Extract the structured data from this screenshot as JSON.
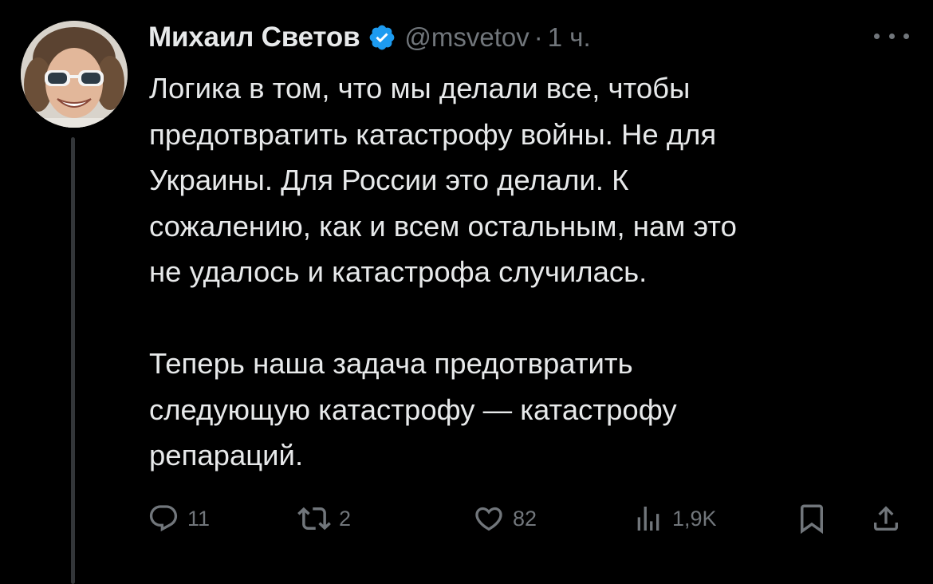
{
  "tweet": {
    "author_name": "Михаил Светов",
    "handle": "@msvetov",
    "separator": "·",
    "time": "1 ч.",
    "paragraphs": [
      [
        "Логика в том, что мы делали все, чтобы",
        "предотвратить катастрофу войны. Не для",
        "Украины. Для России это делали. К",
        "сожалению, как и всем остальным, нам это",
        "не удалось и катастрофа случилась."
      ],
      [
        "Теперь наша задача предотвратить",
        "следующую катастрофу — катастрофу",
        "репараций."
      ]
    ]
  },
  "actions": {
    "replies": "11",
    "retweets": "2",
    "likes": "82",
    "views": "1,9K"
  },
  "icons": {
    "verified": "verified-badge-icon",
    "more": "more-dots-icon",
    "reply": "reply-icon",
    "retweet": "retweet-icon",
    "like": "heart-icon",
    "views": "views-icon",
    "bookmark": "bookmark-icon",
    "share": "share-icon"
  },
  "colors": {
    "background": "#000000",
    "text": "#e7e9ea",
    "muted": "#71767b",
    "verified": "#1d9bf0"
  }
}
